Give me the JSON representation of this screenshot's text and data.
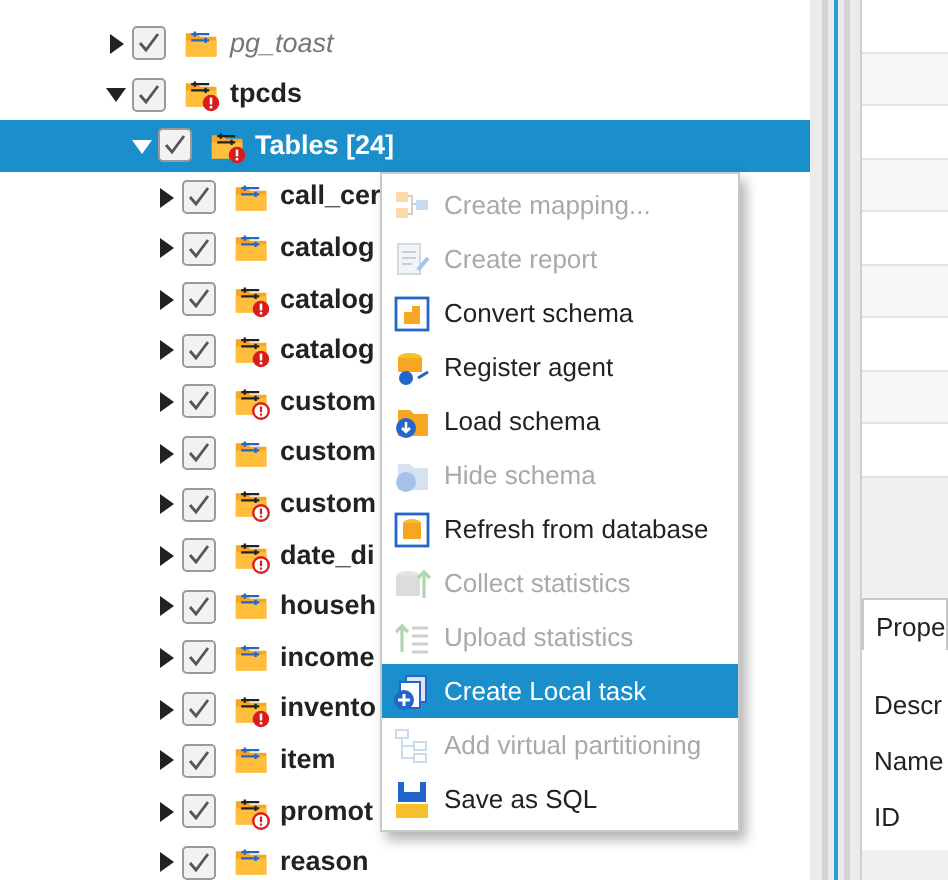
{
  "tree": [
    {
      "label": "pg_toast",
      "kind": "muted",
      "expanded": false,
      "checked": true,
      "selected": false,
      "error": false,
      "warning": false
    },
    {
      "label": "tpcds",
      "kind": "normal",
      "expanded": true,
      "checked": true,
      "selected": false,
      "error": true,
      "warning": false,
      "children": [
        {
          "label": "Tables [24]",
          "kind": "normal",
          "expanded": true,
          "checked": true,
          "selected": true,
          "error": true,
          "warning": false,
          "children": [
            {
              "label": "call_cer",
              "kind": "normal",
              "expanded": false,
              "checked": true,
              "selected": false,
              "error": false,
              "warning": false
            },
            {
              "label": "catalog",
              "kind": "normal",
              "expanded": false,
              "checked": true,
              "selected": false,
              "error": false,
              "warning": false
            },
            {
              "label": "catalog",
              "kind": "normal",
              "expanded": false,
              "checked": true,
              "selected": false,
              "error": true,
              "warning": false
            },
            {
              "label": "catalog",
              "kind": "normal",
              "expanded": false,
              "checked": true,
              "selected": false,
              "error": true,
              "warning": false
            },
            {
              "label": "custom",
              "kind": "normal",
              "expanded": false,
              "checked": true,
              "selected": false,
              "error": false,
              "warning": true
            },
            {
              "label": "custom",
              "kind": "normal",
              "expanded": false,
              "checked": true,
              "selected": false,
              "error": false,
              "warning": false
            },
            {
              "label": "custom",
              "kind": "normal",
              "expanded": false,
              "checked": true,
              "selected": false,
              "error": false,
              "warning": true
            },
            {
              "label": "date_di",
              "kind": "normal",
              "expanded": false,
              "checked": true,
              "selected": false,
              "error": false,
              "warning": true
            },
            {
              "label": "househ",
              "kind": "normal",
              "expanded": false,
              "checked": true,
              "selected": false,
              "error": false,
              "warning": false
            },
            {
              "label": "income",
              "kind": "normal",
              "expanded": false,
              "checked": true,
              "selected": false,
              "error": false,
              "warning": false
            },
            {
              "label": "invento",
              "kind": "normal",
              "expanded": false,
              "checked": true,
              "selected": false,
              "error": true,
              "warning": false
            },
            {
              "label": "item",
              "kind": "normal",
              "expanded": false,
              "checked": true,
              "selected": false,
              "error": false,
              "warning": false
            },
            {
              "label": "promot",
              "kind": "normal",
              "expanded": false,
              "checked": true,
              "selected": false,
              "error": false,
              "warning": true
            },
            {
              "label": "reason",
              "kind": "normal",
              "expanded": false,
              "checked": true,
              "selected": false,
              "error": false,
              "warning": false
            }
          ]
        }
      ]
    }
  ],
  "context_menu": [
    {
      "label": "Create mapping...",
      "disabled": true,
      "selected": false
    },
    {
      "label": "Create report",
      "disabled": true,
      "selected": false
    },
    {
      "label": "Convert schema",
      "disabled": false,
      "selected": false
    },
    {
      "label": "Register agent",
      "disabled": false,
      "selected": false
    },
    {
      "label": "Load schema",
      "disabled": false,
      "selected": false
    },
    {
      "label": "Hide schema",
      "disabled": true,
      "selected": false
    },
    {
      "label": "Refresh from database",
      "disabled": false,
      "selected": false
    },
    {
      "label": "Collect statistics",
      "disabled": true,
      "selected": false
    },
    {
      "label": "Upload statistics",
      "disabled": true,
      "selected": false
    },
    {
      "label": "Create Local task",
      "disabled": false,
      "selected": true
    },
    {
      "label": "Add virtual partitioning",
      "disabled": true,
      "selected": false
    },
    {
      "label": "Save as SQL",
      "disabled": false,
      "selected": false
    }
  ],
  "properties_panel": {
    "tab": "Prope",
    "fields": [
      "Descr",
      "Name",
      "ID"
    ]
  }
}
